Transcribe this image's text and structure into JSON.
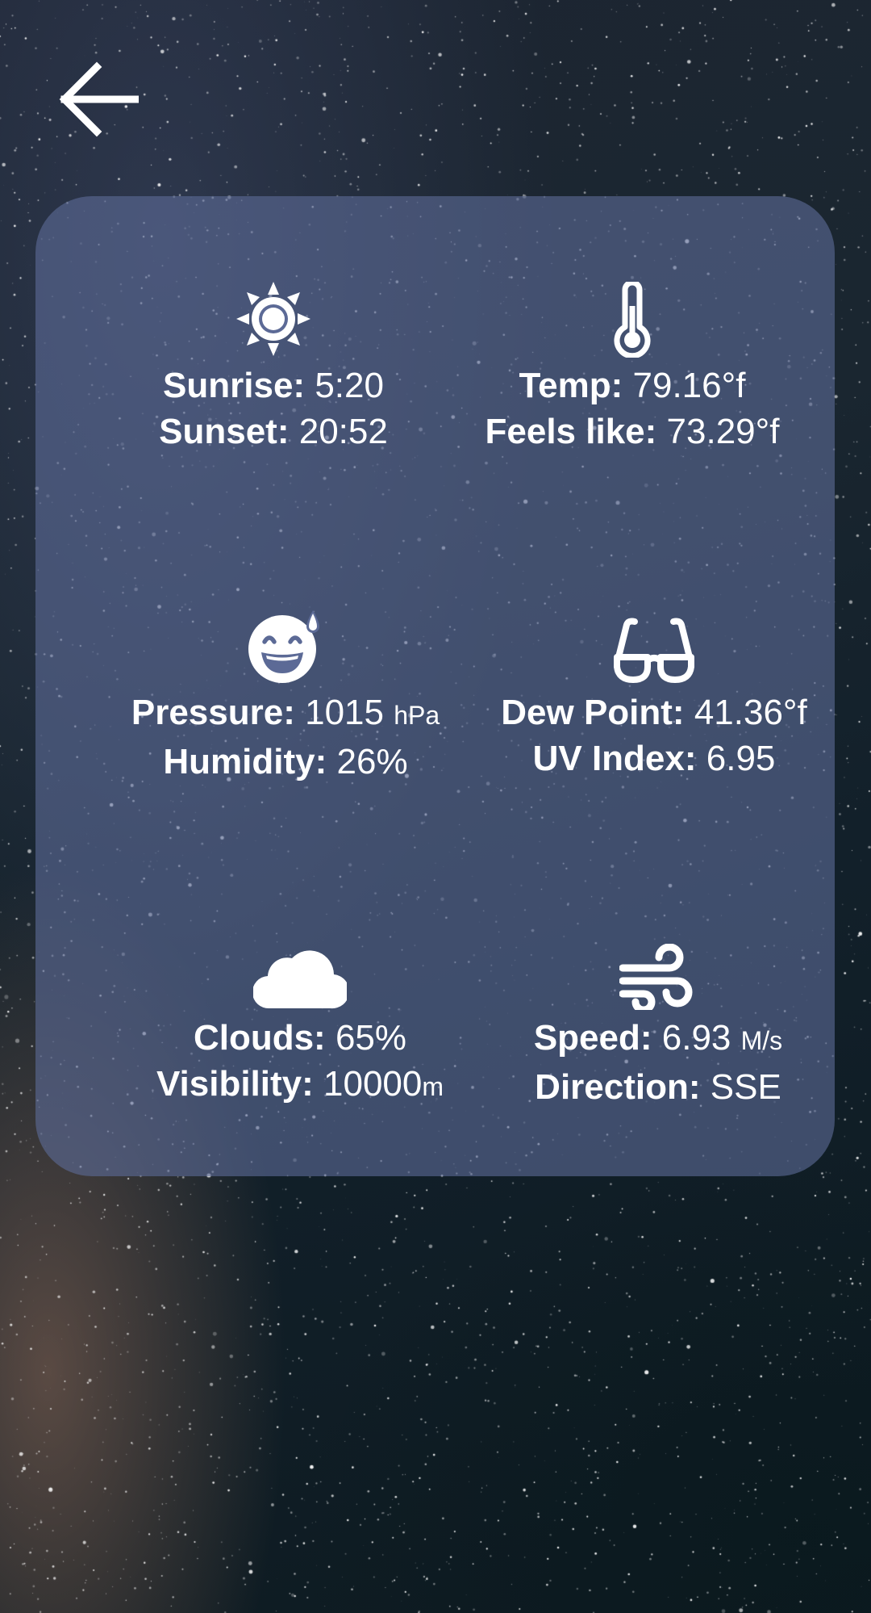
{
  "nav": {
    "back_icon": "arrow-left-icon"
  },
  "panel": {
    "sun": {
      "icon": "sun-icon",
      "sunrise_label": "Sunrise:",
      "sunrise_value": "5:20",
      "sunset_label": "Sunset:",
      "sunset_value": "20:52"
    },
    "temperature": {
      "icon": "thermometer-icon",
      "temp_label": "Temp:",
      "temp_value": "79.16°f",
      "feels_label": "Feels like:",
      "feels_value": "73.29°f"
    },
    "pressure": {
      "icon": "sweat-smile-icon",
      "pressure_label": "Pressure:",
      "pressure_value": "1015",
      "pressure_unit": "hPa",
      "humidity_label": "Humidity:",
      "humidity_value": "26%"
    },
    "dew": {
      "icon": "glasses-icon",
      "dew_label": "Dew Point:",
      "dew_value": "41.36°f",
      "uv_label": "UV Index:",
      "uv_value": "6.95"
    },
    "clouds": {
      "icon": "cloud-icon",
      "clouds_label": "Clouds:",
      "clouds_value": "65%",
      "visibility_label": "Visibility:",
      "visibility_value": "10000",
      "visibility_unit": "m"
    },
    "wind": {
      "icon": "wind-icon",
      "speed_label": "Speed:",
      "speed_value": "6.93",
      "speed_unit": "M/s",
      "direction_label": "Direction:",
      "direction_value": "SSE"
    }
  },
  "colors": {
    "panel": "#5c6a96",
    "text": "#ffffff"
  }
}
